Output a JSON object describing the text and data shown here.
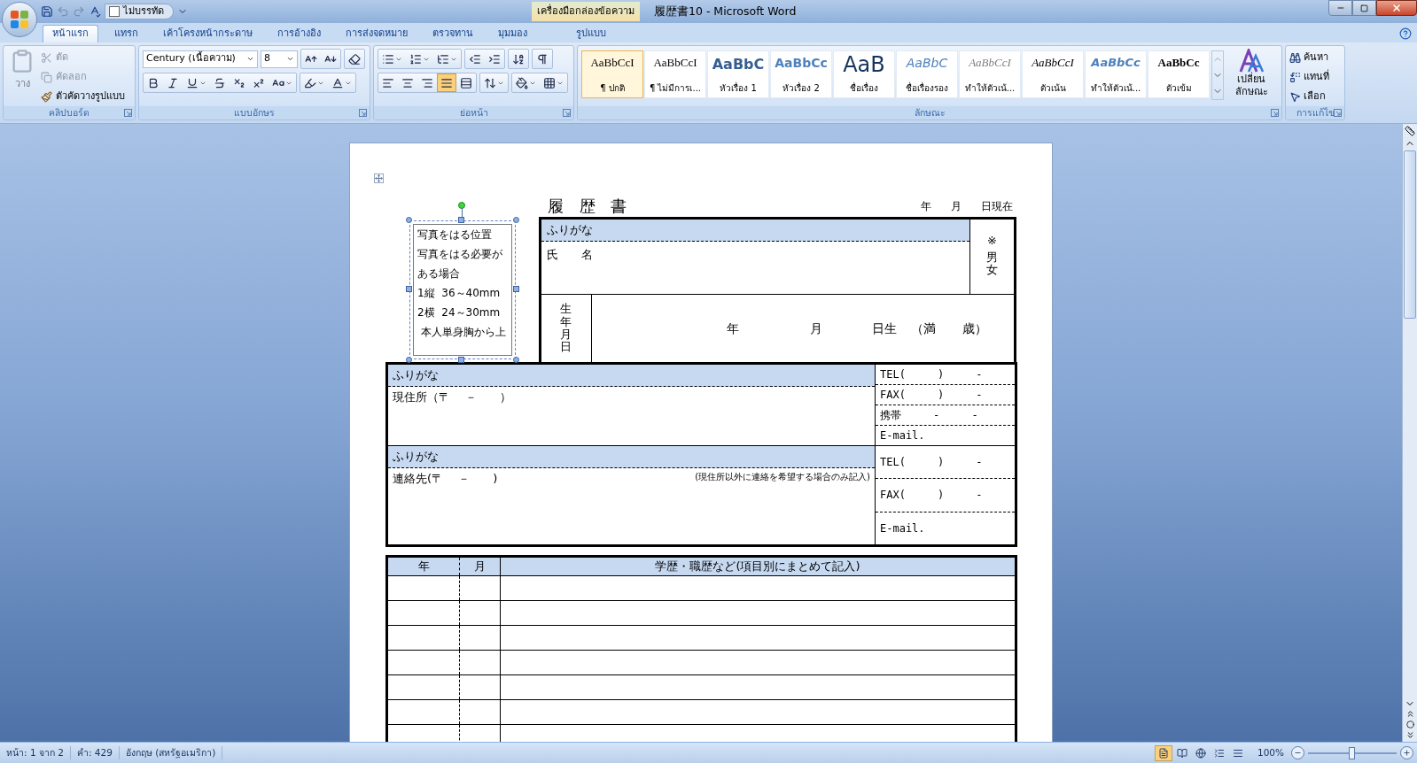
{
  "title_bar": {
    "checkbox": {
      "label": "ไม่บรรทัด",
      "checked": false
    },
    "context_label": "เครื่องมือกล่องข้อความ",
    "title": "履歴書10 - Microsoft Word"
  },
  "ribbon_tabs": [
    {
      "label": "หน้าแรก",
      "selected": true
    },
    {
      "label": "แทรก",
      "selected": false
    },
    {
      "label": "เค้าโครงหน้ากระดาษ",
      "selected": false
    },
    {
      "label": "การอ้างอิง",
      "selected": false
    },
    {
      "label": "การส่งจดหมาย",
      "selected": false
    },
    {
      "label": "ตรวจทาน",
      "selected": false
    },
    {
      "label": "มุมมอง",
      "selected": false
    }
  ],
  "context_tabs": [
    {
      "label": "รูปแบบ",
      "selected": false
    }
  ],
  "clipboard": {
    "label": "คลิปบอร์ด",
    "paste": {
      "label": "วาง",
      "disabled": true
    },
    "buttons": [
      {
        "kind": "cut",
        "label": "ตัด",
        "disabled": true
      },
      {
        "kind": "copy",
        "label": "คัดลอก",
        "disabled": true
      },
      {
        "kind": "painter",
        "label": "ตัวคัดวางรูปแบบ",
        "disabled": false
      }
    ]
  },
  "font": {
    "label": "แบบอักษร",
    "font_name": "Century (เนื้อความ)",
    "font_size": "8"
  },
  "paragraph": {
    "label": "ย่อหน้า",
    "alignment": [
      {
        "kind": "left",
        "selected": false
      },
      {
        "kind": "center",
        "selected": false
      },
      {
        "kind": "right",
        "selected": false
      },
      {
        "kind": "justify",
        "selected": true
      },
      {
        "kind": "distributed",
        "selected": false
      }
    ]
  },
  "styles": {
    "label": "ลักษณะ",
    "items": [
      {
        "kind": "normal",
        "preview": "AaBbCcI",
        "name": "¶ ปกติ",
        "selected": true
      },
      {
        "kind": "normal",
        "preview": "AaBbCcI",
        "name": "¶ ไม่มีการเ...",
        "selected": false
      },
      {
        "kind": "heading1",
        "preview": "AaBbC",
        "name": "หัวเรื่อง 1",
        "selected": false
      },
      {
        "kind": "heading2",
        "preview": "AaBbCc",
        "name": "หัวเรื่อง 2",
        "selected": false
      },
      {
        "kind": "title",
        "preview": "AaB",
        "name": "ชื่อเรื่อง",
        "selected": false
      },
      {
        "kind": "subtitle",
        "preview": "AaBbC",
        "name": "ชื่อเรื่องรอง",
        "selected": false
      },
      {
        "kind": "subtle",
        "preview": "AaBbCcI",
        "name": "ทำให้ตัวเน้...",
        "selected": false
      },
      {
        "kind": "emphasis",
        "preview": "AaBbCcI",
        "name": "ตัวเน้น",
        "selected": false
      },
      {
        "kind": "intense",
        "preview": "AaBbCc",
        "name": "ทำให้ตัวเน้...",
        "selected": false
      },
      {
        "kind": "strong",
        "preview": "AaBbCc",
        "name": "ตัวเข้ม",
        "selected": false
      }
    ],
    "change_styles": "เปลี่ยน ลักษณะ"
  },
  "editing": {
    "label": "การแก้ไข",
    "find": "ค้นหา",
    "replace": "แทนที่",
    "select": "เลือก"
  },
  "document": {
    "title": "履 歴 書",
    "date_parts": [
      "年",
      "月",
      "日現在"
    ],
    "photo_box": {
      "lines": [
        "写真をはる位置",
        "写真をはる必要が",
        "ある場合",
        "1縦  36～40mm",
        "2横  24～30mm",
        "本人単身胸から上"
      ]
    },
    "name_table": {
      "furigana": "ふりがな",
      "name_label": "氏　　名",
      "gender_note": "※",
      "gender": "男女",
      "birth_label": "生年月日",
      "birth_parts": [
        "年",
        "月",
        "日生",
        "（満",
        "歳）"
      ]
    },
    "address_sections": [
      {
        "furigana": "ふりがな",
        "label": "現住所（〒　 －　　）",
        "contacts": [
          "TEL(     )     -",
          "FAX(     )     -",
          "携帯     -     -",
          "E-mail."
        ]
      },
      {
        "furigana": "ふりがな",
        "label": "連絡先(〒　 －　　)",
        "note": "(現住所以外に連絡を希望する場合のみ記入)",
        "contacts": [
          "TEL(     )     -",
          "FAX(     )     -",
          "E-mail."
        ]
      }
    ],
    "history_table": {
      "columns": [
        "年",
        "月",
        "学歴・職歴など(項目別にまとめて記入)"
      ]
    }
  },
  "status_bar": {
    "items": [
      "หน้า: 1 จาก 2",
      "คำ: 429",
      "อังกฤษ (สหรัฐอเมริกา)"
    ],
    "view_buttons": [
      {
        "kind": "print",
        "selected": true
      },
      {
        "kind": "reading",
        "selected": false
      },
      {
        "kind": "web",
        "selected": false
      },
      {
        "kind": "outline",
        "selected": false
      },
      {
        "kind": "draft",
        "selected": false
      }
    ],
    "zoom": "100%",
    "zoom_slider": {
      "level": 0.5
    }
  }
}
